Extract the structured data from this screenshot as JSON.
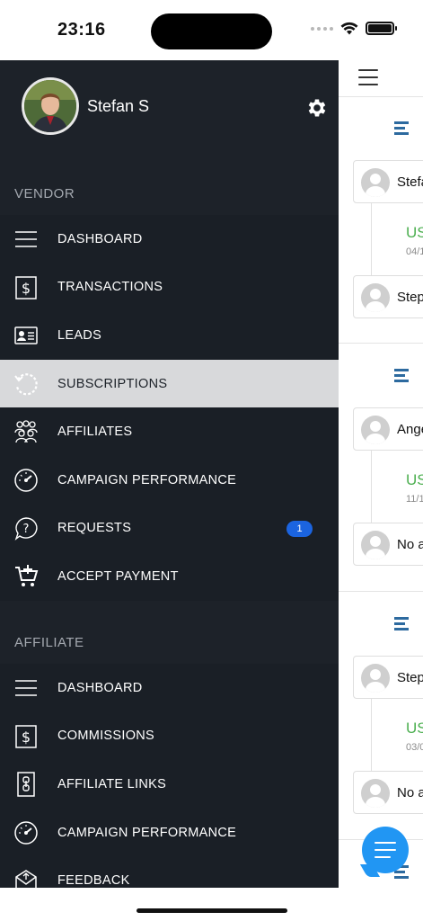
{
  "status_bar": {
    "time": "23:16"
  },
  "profile": {
    "name": "Stefan S"
  },
  "vendor": {
    "header": "VENDOR",
    "items": [
      {
        "label": "DASHBOARD",
        "icon": "list-icon"
      },
      {
        "label": "TRANSACTIONS",
        "icon": "dollar-icon"
      },
      {
        "label": "LEADS",
        "icon": "contact-card-icon"
      },
      {
        "label": "SUBSCRIPTIONS",
        "icon": "refresh-icon",
        "active": true
      },
      {
        "label": "AFFILIATES",
        "icon": "group-icon"
      },
      {
        "label": "CAMPAIGN PERFORMANCE",
        "icon": "speedometer-icon"
      },
      {
        "label": "REQUESTS",
        "icon": "question-bubble-icon",
        "badge": "1"
      },
      {
        "label": "ACCEPT PAYMENT",
        "icon": "cart-plus-icon"
      }
    ]
  },
  "affiliate": {
    "header": "AFFILIATE",
    "items": [
      {
        "label": "DASHBOARD",
        "icon": "list-icon"
      },
      {
        "label": "COMMISSIONS",
        "icon": "dollar-icon"
      },
      {
        "label": "AFFILIATE LINKS",
        "icon": "link-icon"
      },
      {
        "label": "CAMPAIGN PERFORMANCE",
        "icon": "speedometer-icon"
      },
      {
        "label": "FEEDBACK",
        "icon": "mail-icon"
      }
    ]
  },
  "content": {
    "cards": [
      {
        "name": "Stefa",
        "amount": "US",
        "date": "04/1",
        "reply": "Step"
      },
      {
        "name": "Ange",
        "amount": "US",
        "date": "11/1",
        "reply": "No a"
      },
      {
        "name": "Step",
        "amount": "US",
        "date": "03/0",
        "reply": "No a"
      }
    ]
  },
  "colors": {
    "drawer_bg": "#1d2229",
    "active_bg": "#d8d9db",
    "badge": "#1b64e0",
    "amount_green": "#4caf50",
    "fab": "#2196f3"
  }
}
